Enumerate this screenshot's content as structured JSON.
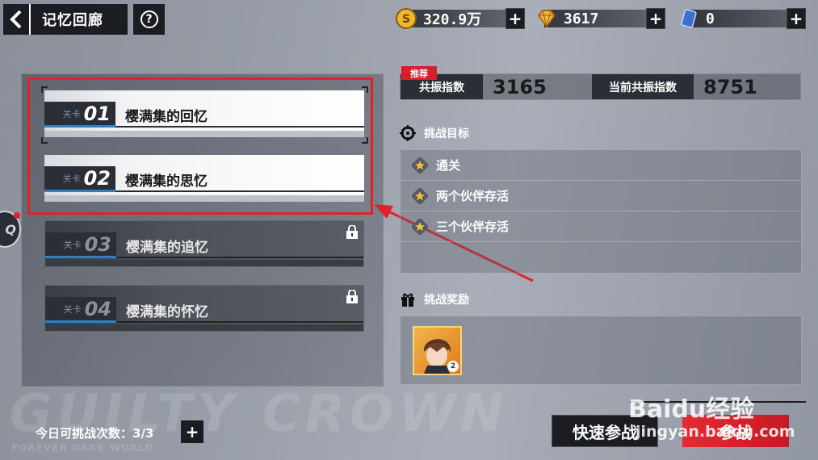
{
  "header": {
    "title": "记忆回廊",
    "help_label": "?"
  },
  "currencies": [
    {
      "icon": "coin-icon",
      "value": "320.9万"
    },
    {
      "icon": "diamond-icon",
      "value": "3617"
    },
    {
      "icon": "ticket-icon",
      "value": "0"
    }
  ],
  "plus_label": "+",
  "levels": [
    {
      "prefix": "关卡",
      "number": "01",
      "name": "樱满集的回忆",
      "locked": false
    },
    {
      "prefix": "关卡",
      "number": "02",
      "name": "樱满集的思忆",
      "locked": false
    },
    {
      "prefix": "关卡",
      "number": "03",
      "name": "樱满集的追忆",
      "locked": true
    },
    {
      "prefix": "关卡",
      "number": "04",
      "name": "樱满集的怀忆",
      "locked": true
    }
  ],
  "stats": {
    "recommend_tag": "推荐",
    "resonance_label": "共振指数",
    "resonance_value": "3165",
    "current_label": "当前共振指数",
    "current_value": "8751"
  },
  "goals": {
    "heading": "挑战目标",
    "items": [
      "通关",
      "两个伙伴存活",
      "三个伙伴存活"
    ]
  },
  "rewards": {
    "heading": "挑战奖励",
    "items": [
      {
        "icon": "character-portrait-icon",
        "count": "2"
      }
    ]
  },
  "challenge": {
    "label": "今日可挑战次数：",
    "value": "3/3"
  },
  "buttons": {
    "quick": "快速参战",
    "fight": "参战"
  },
  "watermark": {
    "main": "GUILTY CROWN",
    "sub": "FOREVER DARK WORLD"
  },
  "side_bubble": "Q",
  "baidu": {
    "logo": "Baidu经验",
    "url": "jingyan.baidu.com"
  },
  "colors": {
    "accent_red": "#e2222b",
    "dark": "#1b1d22",
    "level_blue": "#2f7fc1"
  }
}
